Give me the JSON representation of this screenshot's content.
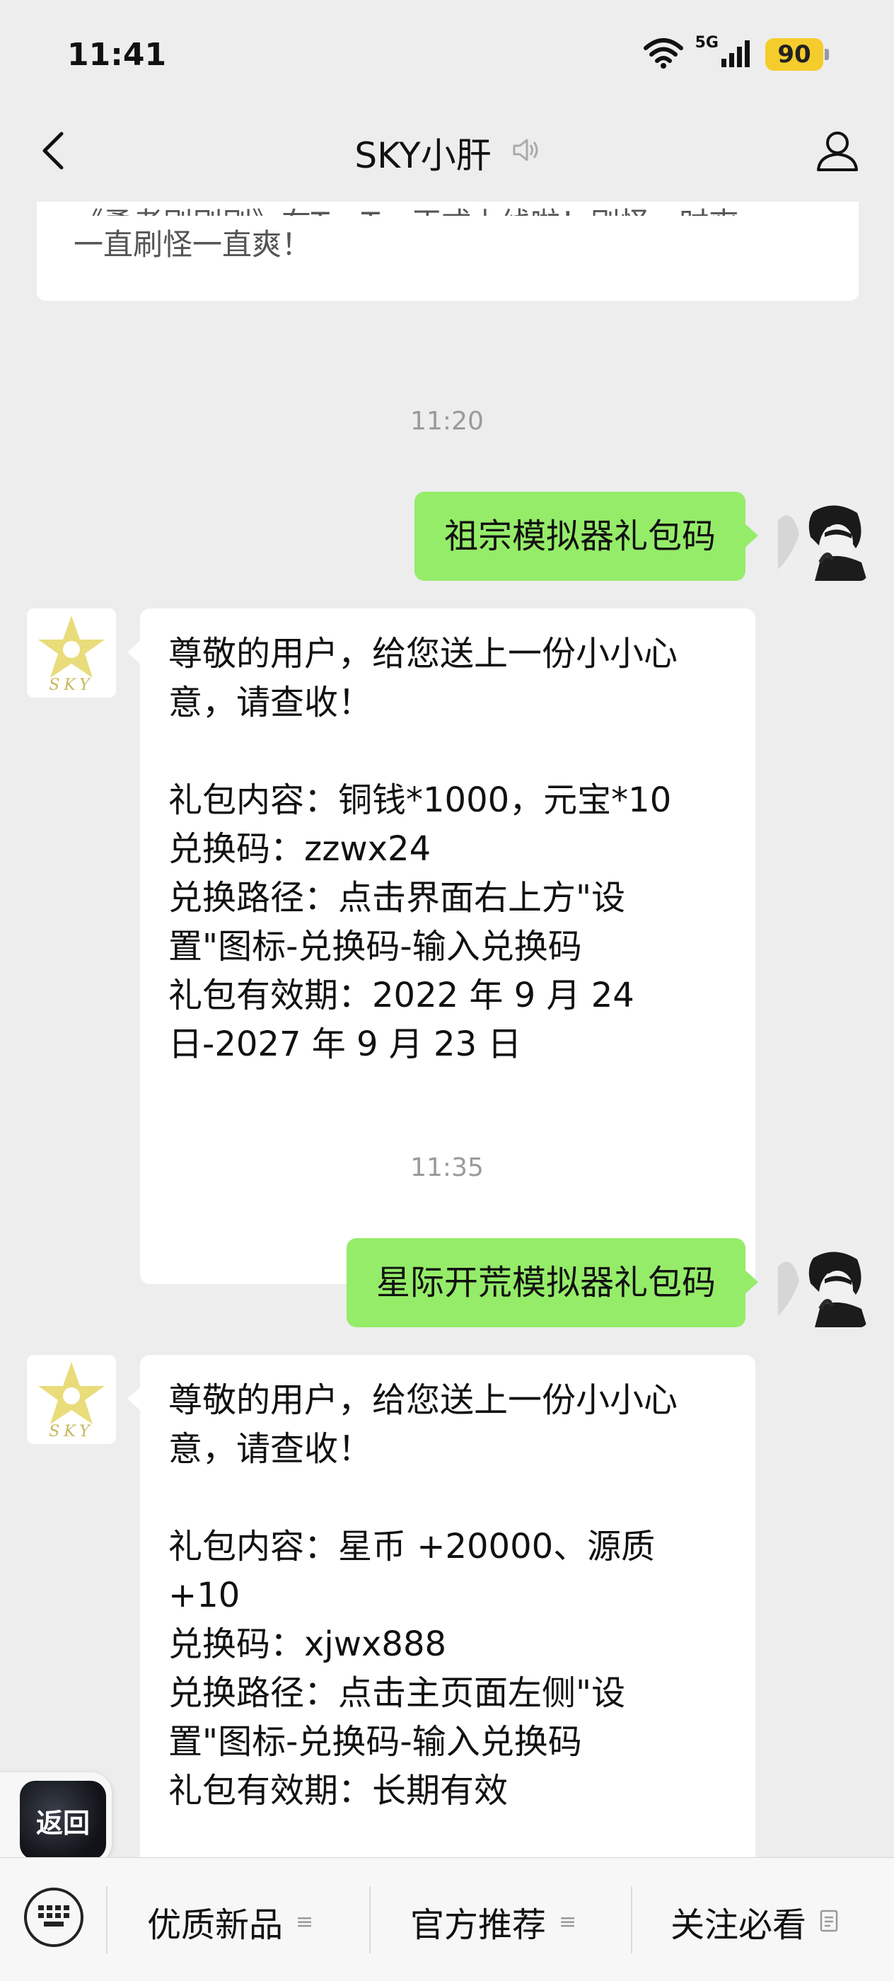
{
  "status_bar": {
    "time": "11:41",
    "network": "5G",
    "battery": "90"
  },
  "nav": {
    "title": "SKY小肝"
  },
  "chat": {
    "top_card": {
      "line1": "《勇者刷刷刷》在TapTap正式上线啦！刷怪一时爽，",
      "line2": "一直刷怪一直爽！"
    },
    "messages": [
      {
        "type": "timestamp",
        "text": "11:20"
      },
      {
        "type": "sent",
        "text": "祖宗模拟器礼包码"
      },
      {
        "type": "received",
        "text": "尊敬的用户，给您送上一份小小心\n意，请查收！\n\n礼包内容：铜钱*1000，元宝*10\n兑换码：zzwx24\n兑换路径：点击界面右上方\"设\n置\"图标-兑换码-输入兑换码\n礼包有效期：2022 年 9 月 24\n日-2027 年 9 月 23 日"
      },
      {
        "type": "timestamp",
        "text": "11:35"
      },
      {
        "type": "sent",
        "text": "星际开荒模拟器礼包码"
      },
      {
        "type": "received",
        "text": "尊敬的用户，给您送上一份小小心\n意，请查收！\n\n礼包内容：星币 +20000、源质\n+10\n兑换码：xjwx888\n兑换路径：点击主页面左侧\"设\n置\"图标-兑换码-输入兑换码\n礼包有效期：长期有效"
      }
    ]
  },
  "sky_avatar_text": "SKY",
  "return_button": {
    "label": "返回"
  },
  "bottom_menu": {
    "items": [
      {
        "label": "优质新品"
      },
      {
        "label": "官方推荐"
      },
      {
        "label": "关注必看"
      }
    ]
  },
  "colors": {
    "sent_bubble": "#95ec69",
    "background": "#ededed",
    "battery": "#f4cc2c"
  }
}
